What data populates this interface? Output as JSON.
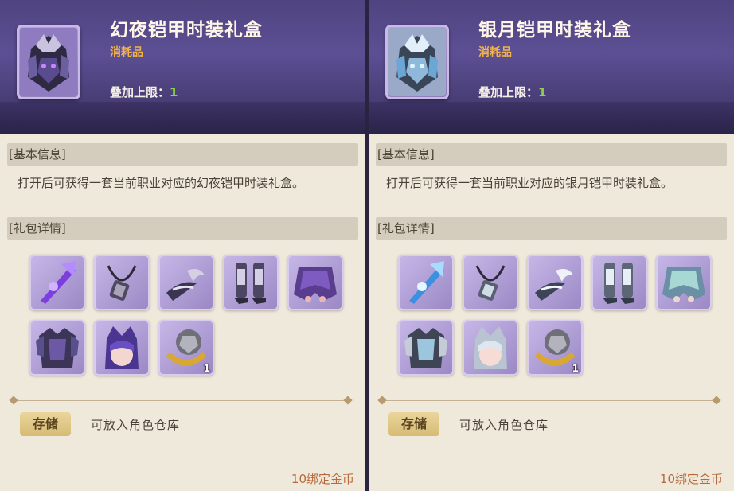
{
  "cards": [
    {
      "title": "幻夜铠甲时装礼盒",
      "tag": "消耗品",
      "stack_label": "叠加上限：",
      "stack_value": "1",
      "section_basic": "[基本信息]",
      "description": "打开后可获得一套当前职业对应的幻夜铠甲时装礼盒。",
      "section_pack": "[礼包详情]",
      "items": [
        {
          "icon": "weapon-icon"
        },
        {
          "icon": "necklace-icon"
        },
        {
          "icon": "ornament-icon"
        },
        {
          "icon": "boots-icon"
        },
        {
          "icon": "skirt-icon"
        },
        {
          "icon": "armor-icon"
        },
        {
          "icon": "hair-icon"
        },
        {
          "icon": "ring-icon",
          "count": "1"
        }
      ],
      "storage_button": "存储",
      "storage_text": "可放入角色仓库",
      "price": "10绑定金币",
      "theme_color": "#7a4fd0"
    },
    {
      "title": "银月铠甲时装礼盒",
      "tag": "消耗品",
      "stack_label": "叠加上限：",
      "stack_value": "1",
      "section_basic": "[基本信息]",
      "description": "打开后可获得一套当前职业对应的银月铠甲时装礼盒。",
      "section_pack": "[礼包详情]",
      "items": [
        {
          "icon": "weapon-icon"
        },
        {
          "icon": "necklace-icon"
        },
        {
          "icon": "ornament-icon"
        },
        {
          "icon": "boots-icon"
        },
        {
          "icon": "skirt-icon"
        },
        {
          "icon": "armor-icon"
        },
        {
          "icon": "hair-icon"
        },
        {
          "icon": "ring-icon",
          "count": "1"
        }
      ],
      "storage_button": "存储",
      "storage_text": "可放入角色仓库",
      "price": "10绑定金币",
      "theme_color": "#7fb6e0"
    }
  ]
}
